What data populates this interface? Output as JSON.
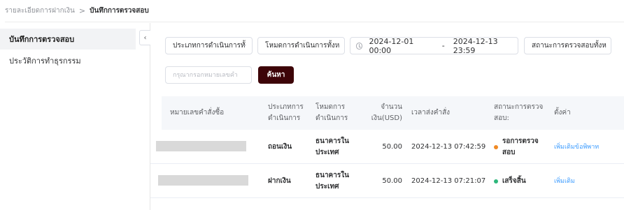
{
  "breadcrumb": {
    "parent": "รายละเอียดการฝากเงิน",
    "separator": ">",
    "current": "บันทึกการตรวจสอบ"
  },
  "sidebar": {
    "items": [
      {
        "label": "บันทึกการตรวจสอบ",
        "active": true
      },
      {
        "label": "ประวัติการทำธุรกรรม",
        "active": false
      }
    ],
    "collapse_icon": "‹"
  },
  "filters": {
    "operation_type": "ประเภทการดำเนินการทั้",
    "operation_mode": "โหมดการดำเนินการทั้งห",
    "date_start": "2024-12-01 00:00",
    "date_separator": "-",
    "date_end": "2024-12-13 23:59",
    "audit_status": "สถานะการตรวจสอบทั้งห",
    "search_placeholder": "กรุณากรอกหมายเลขคำ",
    "search_button": "ค้นหา",
    "chevron": "⌄"
  },
  "table": {
    "headers": {
      "order_no": "หมายเลขคำสั่งซื้อ",
      "type": "ประเภทการดำเนินการ",
      "mode": "โหมดการดำเนินการ",
      "amount": "จำนวนเงิน(USD)",
      "time": "เวลาส่งคำสั่ง",
      "status": "สถานะการตรวจสอบ:",
      "settings": "ตั้งค่า"
    },
    "rows": [
      {
        "type": "ถอนเงิน",
        "mode": "ธนาคารในประเทศ",
        "amount": "50.00",
        "time": "2024-12-13 07:42:59",
        "status": "รอการตรวจสอบ",
        "status_color": "#f08a24",
        "action": "เพิ่มเติมข้อพิพาท"
      },
      {
        "type": "ฝากเงิน",
        "mode": "ธนาคารในประเทศ",
        "amount": "50.00",
        "time": "2024-12-13 07:21:07",
        "status": "เสร็จสิ้น",
        "status_color": "#2db77b",
        "action": "เพิ่มเติม"
      }
    ]
  }
}
